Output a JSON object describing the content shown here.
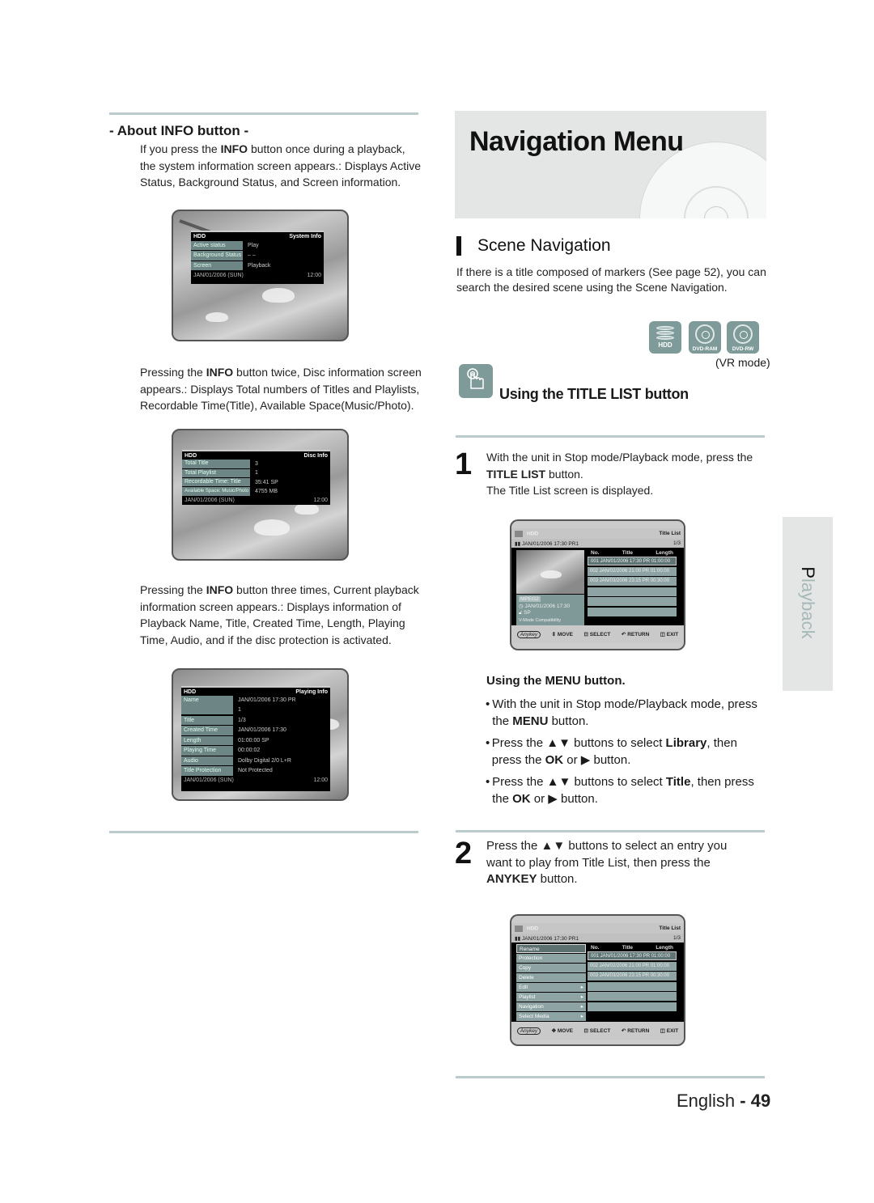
{
  "left": {
    "about_title": "- About INFO button -",
    "intro": [
      "If you press the ",
      "INFO",
      " button once during a playback, the system information screen appears.: Displays Active Status, Background Status, and Screen information."
    ],
    "system_info_screen": {
      "device": "HDD",
      "title": "System Info",
      "rows": [
        {
          "label": "Active status",
          "value": "Play"
        },
        {
          "label": "Background Status",
          "value": "– –"
        },
        {
          "label": "Screen",
          "value": "Playback"
        }
      ],
      "date": "JAN/01/2006 (SUN)",
      "time": "12:00"
    },
    "twice_text": [
      "Pressing the ",
      "INFO",
      " button twice, Disc information screen appears.: Displays Total numbers of Titles and Playlists, Recordable Time(Title), Available Space(Music/Photo)."
    ],
    "disc_info_screen": {
      "device": "HDD",
      "title": "Disc Info",
      "rows": [
        {
          "label": "Total Title",
          "value": "3"
        },
        {
          "label": "Total Playlist",
          "value": "1"
        },
        {
          "label": "Recordable Time: Title",
          "value": "35:41  SP"
        },
        {
          "label": "Available Space: Music/Photo",
          "value": "4755 MB"
        }
      ],
      "date": "JAN/01/2006 (SUN)",
      "time": "12:00"
    },
    "three_text": [
      "Pressing the ",
      "INFO",
      " button three times, Current playback information screen appears.: Displays information of Playback Name, Title, Created Time, Length, Playing Time, Audio, and if the disc protection is activated."
    ],
    "playing_info_screen": {
      "device": "HDD",
      "title": "Playing Info",
      "name_label": "Name",
      "name_value": "JAN/01/2006 17:30 PR",
      "name_value2": "1",
      "rows": [
        {
          "label": "Title",
          "value": "1/3"
        },
        {
          "label": "Created Time",
          "value": "JAN/01/2006 17:30"
        },
        {
          "label": "Length",
          "value": "01:00:00 SP"
        },
        {
          "label": "Playing Time",
          "value": "00:00:02"
        },
        {
          "label": "Audio",
          "value": "Dolby Digital 2/0 L+R"
        },
        {
          "label": "Title Protection",
          "value": "Not Protected"
        }
      ],
      "date": "JAN/01/2006 (SUN)",
      "time": "12:00"
    }
  },
  "right": {
    "banner_title": "Navigation Menu",
    "section_title": "Scene Navigation",
    "section_text": "If there is a title composed of markers (See page 52), you can search the desired scene using the Scene Navigation.",
    "media_icons": [
      {
        "name": "hdd-icon",
        "label": "HDD"
      },
      {
        "name": "dvd-ram-icon",
        "label": "DVD-RAM"
      },
      {
        "name": "dvd-rw-icon",
        "label": "DVD-RW"
      }
    ],
    "vr_mode": "(VR mode)",
    "subsection_title": "Using the TITLE LIST button",
    "step1": {
      "num": "1",
      "line1": "With the unit in Stop mode/Playback mode, press the",
      "bold": "TITLE LIST",
      "after_bold": " button.",
      "line3": "The Title List screen is displayed."
    },
    "title_list_1": {
      "device": "HDD",
      "title": "Title List",
      "current": "JAN/01/2006 17:30 PR1",
      "page": "1/3",
      "headers": [
        "No.",
        "Title",
        "Length"
      ],
      "rows": [
        "001  JAN/01/2006 17:30 PR  01:00:00",
        "002  JAN/02/2006 21:00 PR  01:00:00",
        "003  JAN/03/2006 23:15 PR  00:30:00"
      ],
      "info_badge": "MPEG2",
      "info_date": "JAN/01/2006 17:30",
      "info_mode": "SP",
      "info_compat": "V-Mode Compatibility",
      "footer": [
        "Anykey",
        "MOVE",
        "SELECT",
        "RETURN",
        "EXIT"
      ]
    },
    "menu_heading": "Using the MENU button.",
    "menu_bullets": [
      [
        "With the unit in Stop mode/Playback mode, press the ",
        "MENU",
        " button."
      ],
      [
        "Press the ▲▼ buttons to select ",
        "Library",
        ", then press the ",
        "OK",
        " or ▶ button."
      ],
      [
        "Press the ▲▼ buttons to select ",
        "Title",
        ", then press the ",
        "OK",
        " or ▶ button."
      ]
    ],
    "step2": {
      "num": "2",
      "text": "Press the ▲▼ buttons to select an entry you want to play from Title List, then press the",
      "bold": "ANYKEY",
      "after_bold": " button."
    },
    "title_list_2": {
      "device": "HDD",
      "title": "Title List",
      "current": "JAN/01/2006 17:30 PR1",
      "page": "1/3",
      "headers": [
        "No.",
        "Title",
        "Length"
      ],
      "rows": [
        "001  JAN/01/2006 17:30 PR  01:00:00",
        "002  JAN/02/2006 21:00 PR  01:00:00",
        "003  JAN/03/2006 23:15 PR  00:30:00"
      ],
      "menu": [
        {
          "label": "Rename",
          "arrow": ""
        },
        {
          "label": "Protection",
          "arrow": ""
        },
        {
          "label": "Copy",
          "arrow": ""
        },
        {
          "label": "Delete",
          "arrow": ""
        },
        {
          "label": "Edit",
          "arrow": "▸"
        },
        {
          "label": "Playlist",
          "arrow": "▸"
        },
        {
          "label": "Navigation",
          "arrow": "▸"
        },
        {
          "label": "Select Media",
          "arrow": "▸"
        }
      ],
      "footer": [
        "Anykey",
        "MOVE",
        "SELECT",
        "RETURN",
        "EXIT"
      ]
    },
    "side_tab_first": "P",
    "side_tab_rest": "layback",
    "footer_lang": "English",
    "footer_sep": " - ",
    "page_number": "49"
  }
}
